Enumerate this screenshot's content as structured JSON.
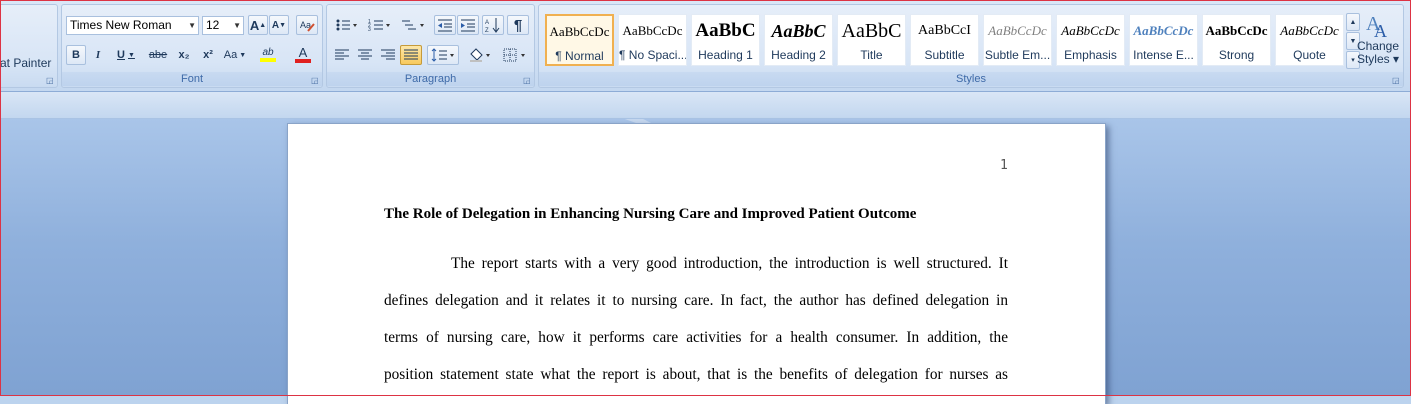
{
  "clipboard": {
    "format_painter_label": "at Painter"
  },
  "font": {
    "group_label": "Font",
    "family": "Times New Roman",
    "size": "12",
    "grow_label": "A",
    "shrink_label": "A",
    "bold_label": "B",
    "italic_label": "I",
    "underline_label": "U",
    "strike_label": "abe",
    "subscript_label": "x₂",
    "superscript_label": "x²",
    "case_label": "Aa",
    "highlight_label": "ab",
    "color_label": "A"
  },
  "paragraph": {
    "group_label": "Paragraph",
    "show_marks_label": "¶"
  },
  "styles": {
    "group_label": "Styles",
    "items": [
      {
        "sample": "AaBbCcDc",
        "name": "¶ Normal"
      },
      {
        "sample": "AaBbCcDc",
        "name": "¶ No Spaci..."
      },
      {
        "sample": "AaBbC",
        "name": "Heading 1"
      },
      {
        "sample": "AaBbC",
        "name": "Heading 2"
      },
      {
        "sample": "AaBbC",
        "name": "Title"
      },
      {
        "sample": "AaBbCcI",
        "name": "Subtitle"
      },
      {
        "sample": "AaBbCcDc",
        "name": "Subtle Em..."
      },
      {
        "sample": "AaBbCcDc",
        "name": "Emphasis"
      },
      {
        "sample": "AaBbCcDc",
        "name": "Intense E..."
      },
      {
        "sample": "AaBbCcDc",
        "name": "Strong"
      },
      {
        "sample": "AaBbCcDc",
        "name": "Quote"
      }
    ],
    "change_styles_line1": "Change",
    "change_styles_line2": "Styles ▾"
  },
  "colors": {
    "highlight": "#ffff00",
    "font_color": "#e02020",
    "accent": "#3e6aa8"
  },
  "document": {
    "page_number": "1",
    "title": "The Role of Delegation in Enhancing Nursing Care and Improved Patient Outcome",
    "lines": [
      "The report starts with a very good introduction, the introduction is well structured. It",
      "defines delegation and it relates it to nursing care. In fact, the author has defined delegation in",
      "terms of nursing care, how it performs care activities for a health consumer. In addition, the",
      "position statement state what the report is about, that is the benefits of delegation for nurses as"
    ]
  }
}
